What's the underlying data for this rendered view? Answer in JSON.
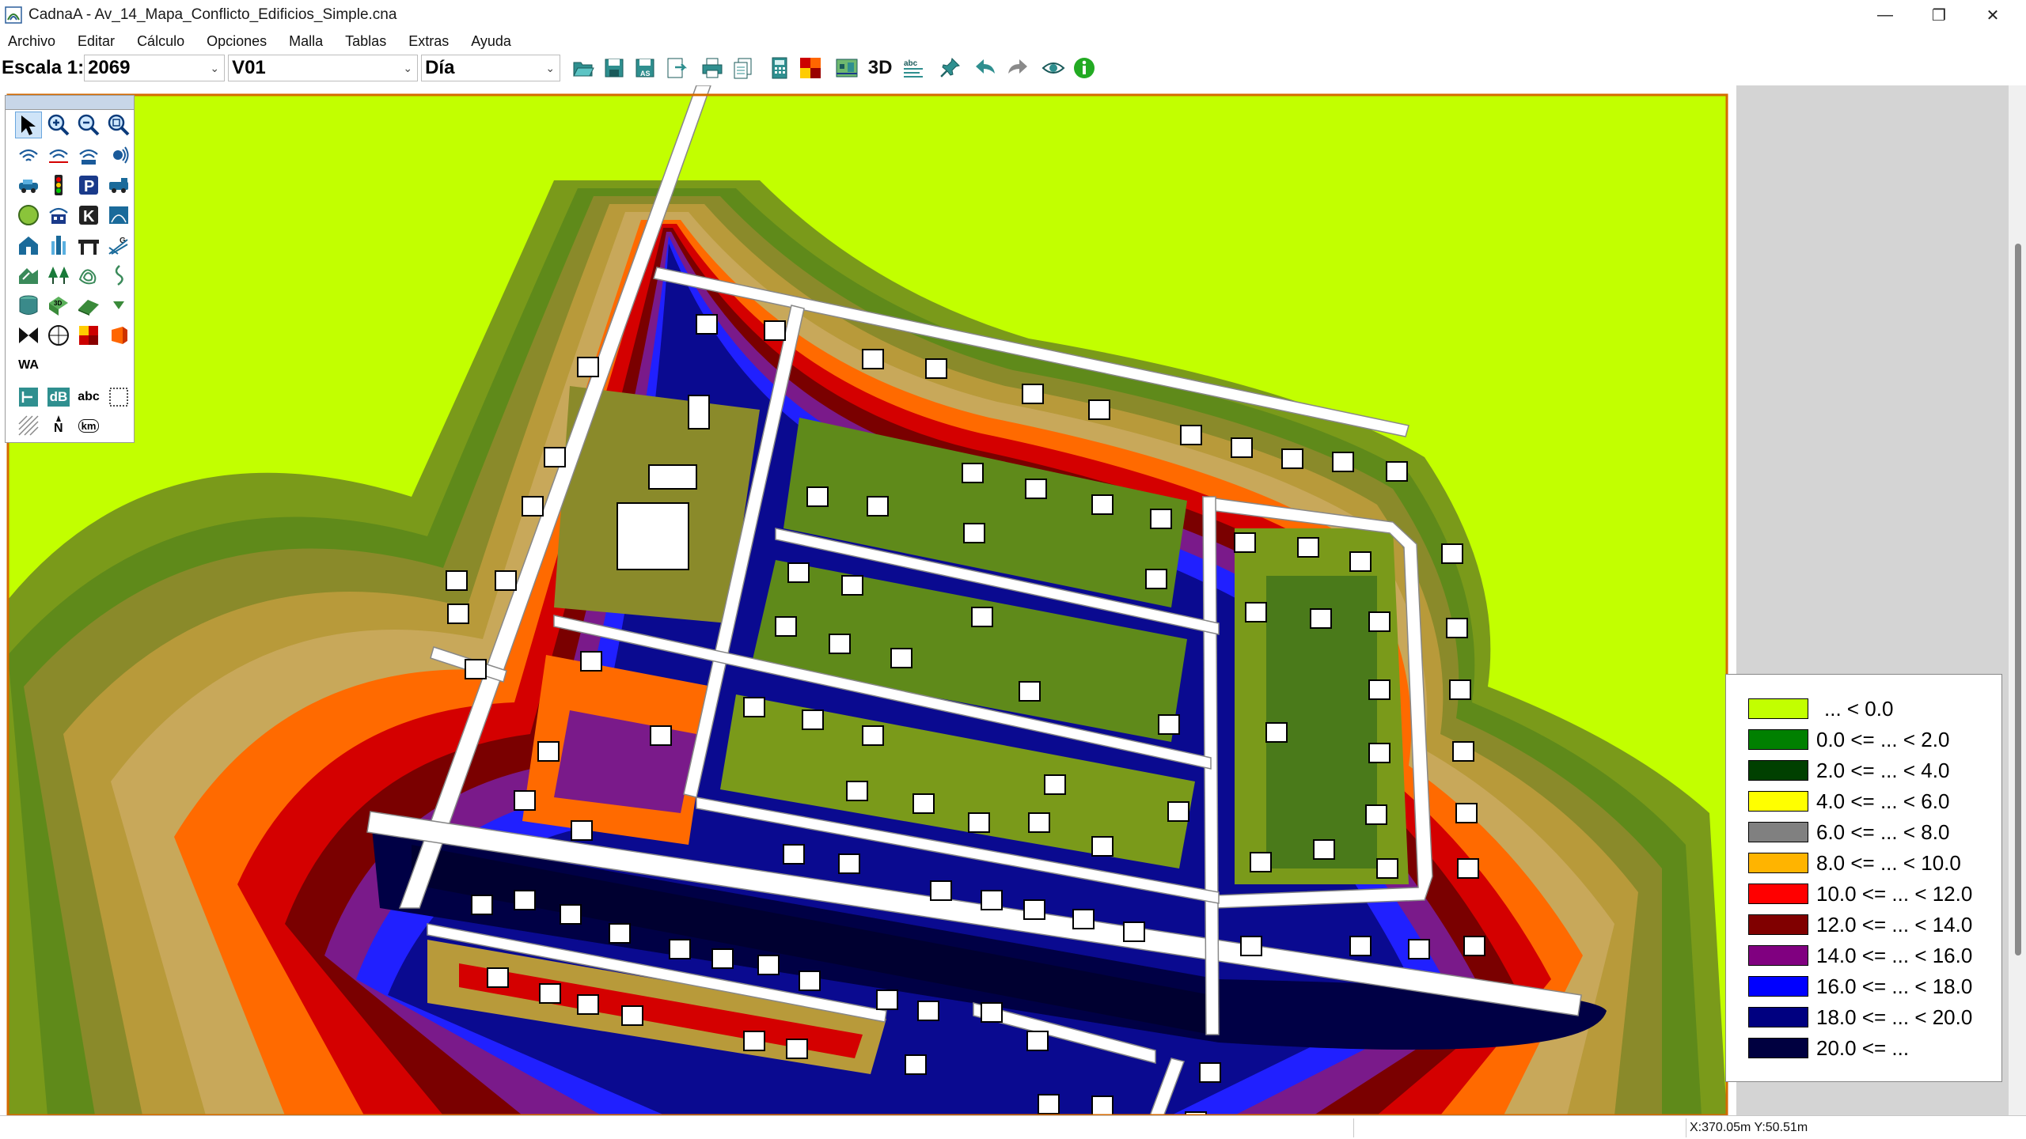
{
  "window": {
    "title": "CadnaA - Av_14_Mapa_Conflicto_Edificios_Simple.cna",
    "controls": [
      "minimize-icon",
      "restore-icon",
      "close-icon"
    ]
  },
  "menu": [
    "Archivo",
    "Editar",
    "Cálculo",
    "Opciones",
    "Malla",
    "Tablas",
    "Extras",
    "Ayuda"
  ],
  "toolbar": {
    "scale_label": "Escala 1:",
    "scale_value": "2069",
    "variant_value": "V01",
    "period_value": "Día",
    "threed_label": "3D",
    "icons": [
      "open-icon",
      "save-icon",
      "save-all-icon",
      "save-as-icon",
      "export-icon",
      "print-icon",
      "copy-icon",
      "calculator-icon",
      "color-grid-icon",
      "grid-map-icon",
      "3d-label",
      "text-tool-icon",
      "pin-icon",
      "undo-icon",
      "redo-icon",
      "eye-icon",
      "info-icon"
    ]
  },
  "palette": {
    "wa_label": "WA",
    "db_label": "dB",
    "abc_label": "abc",
    "n_label": "N",
    "km_label": "km"
  },
  "legend": {
    "entries": [
      {
        "label": "... < 0.0",
        "color": "#c2ff00"
      },
      {
        "label": "0.0 <= ... < 2.0",
        "color": "#008000"
      },
      {
        "label": "2.0 <= ... < 4.0",
        "color": "#004000"
      },
      {
        "label": "4.0 <= ... < 6.0",
        "color": "#ffff00"
      },
      {
        "label": "6.0 <= ... < 8.0",
        "color": "#808080"
      },
      {
        "label": "8.0 <= ... < 10.0",
        "color": "#ffb400"
      },
      {
        "label": "10.0 <= ... < 12.0",
        "color": "#ff0000"
      },
      {
        "label": "12.0 <= ... < 14.0",
        "color": "#800000"
      },
      {
        "label": "14.0 <= ... < 16.0",
        "color": "#800080"
      },
      {
        "label": "16.0 <= ... < 18.0",
        "color": "#0000ff"
      },
      {
        "label": "18.0 <= ... < 20.0",
        "color": "#000080"
      },
      {
        "label": "20.0 <= ...",
        "color": "#000040"
      }
    ]
  },
  "status": {
    "coords": "X:370.05m Y:50.51m"
  }
}
